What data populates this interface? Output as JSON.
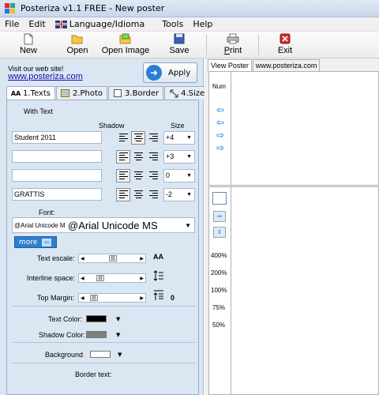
{
  "window": {
    "title": "Posteriza v1.1 FREE - New poster"
  },
  "menu": {
    "file": "File",
    "edit": "Edit",
    "language": "Language/Idioma",
    "tools": "Tools",
    "help": "Help"
  },
  "toolbar": {
    "new_label": "New",
    "open_label": "Open",
    "open_image_label": "Open Image",
    "save_label": "Save",
    "print_label": "Print",
    "exit_label": "Exit"
  },
  "left": {
    "visit_text": "Visit our web site!",
    "website": "www.posteriza.com",
    "apply_label": "Apply",
    "tabs": [
      "1.Texts",
      "2.Photo",
      "3.Border",
      "4.Size"
    ],
    "with_text_label": "With Text",
    "shadow_label": "Shadow",
    "size_label": "Size",
    "rows": [
      {
        "text": "Student 2011",
        "size": "+4"
      },
      {
        "text": "",
        "size": "+3"
      },
      {
        "text": "",
        "size": "0"
      },
      {
        "text": "GRATTIS",
        "size": "-2"
      }
    ],
    "font_label": "Font:",
    "font_value_small": "@Arial Unicode M",
    "font_value_large": "@Arial Unicode MS",
    "more_label": "more",
    "text_escale_label": "Text escale:",
    "interline_label": "Interline space:",
    "top_margin_label": "Top Margin:",
    "top_margin_value": "0",
    "text_color_label": "Text Color:",
    "shadow_color_label": "Shadow Color:",
    "background_label": "Background",
    "border_text_label": "Border text:",
    "colors": {
      "text": "#000000",
      "shadow": "#808080",
      "background": "#ffffff"
    }
  },
  "right": {
    "tabs": [
      "View Poster",
      "www.posteriza.com"
    ],
    "num_label": "Num",
    "zoom_levels": [
      "400%",
      "200%",
      "100%",
      "75%",
      "50%"
    ]
  }
}
